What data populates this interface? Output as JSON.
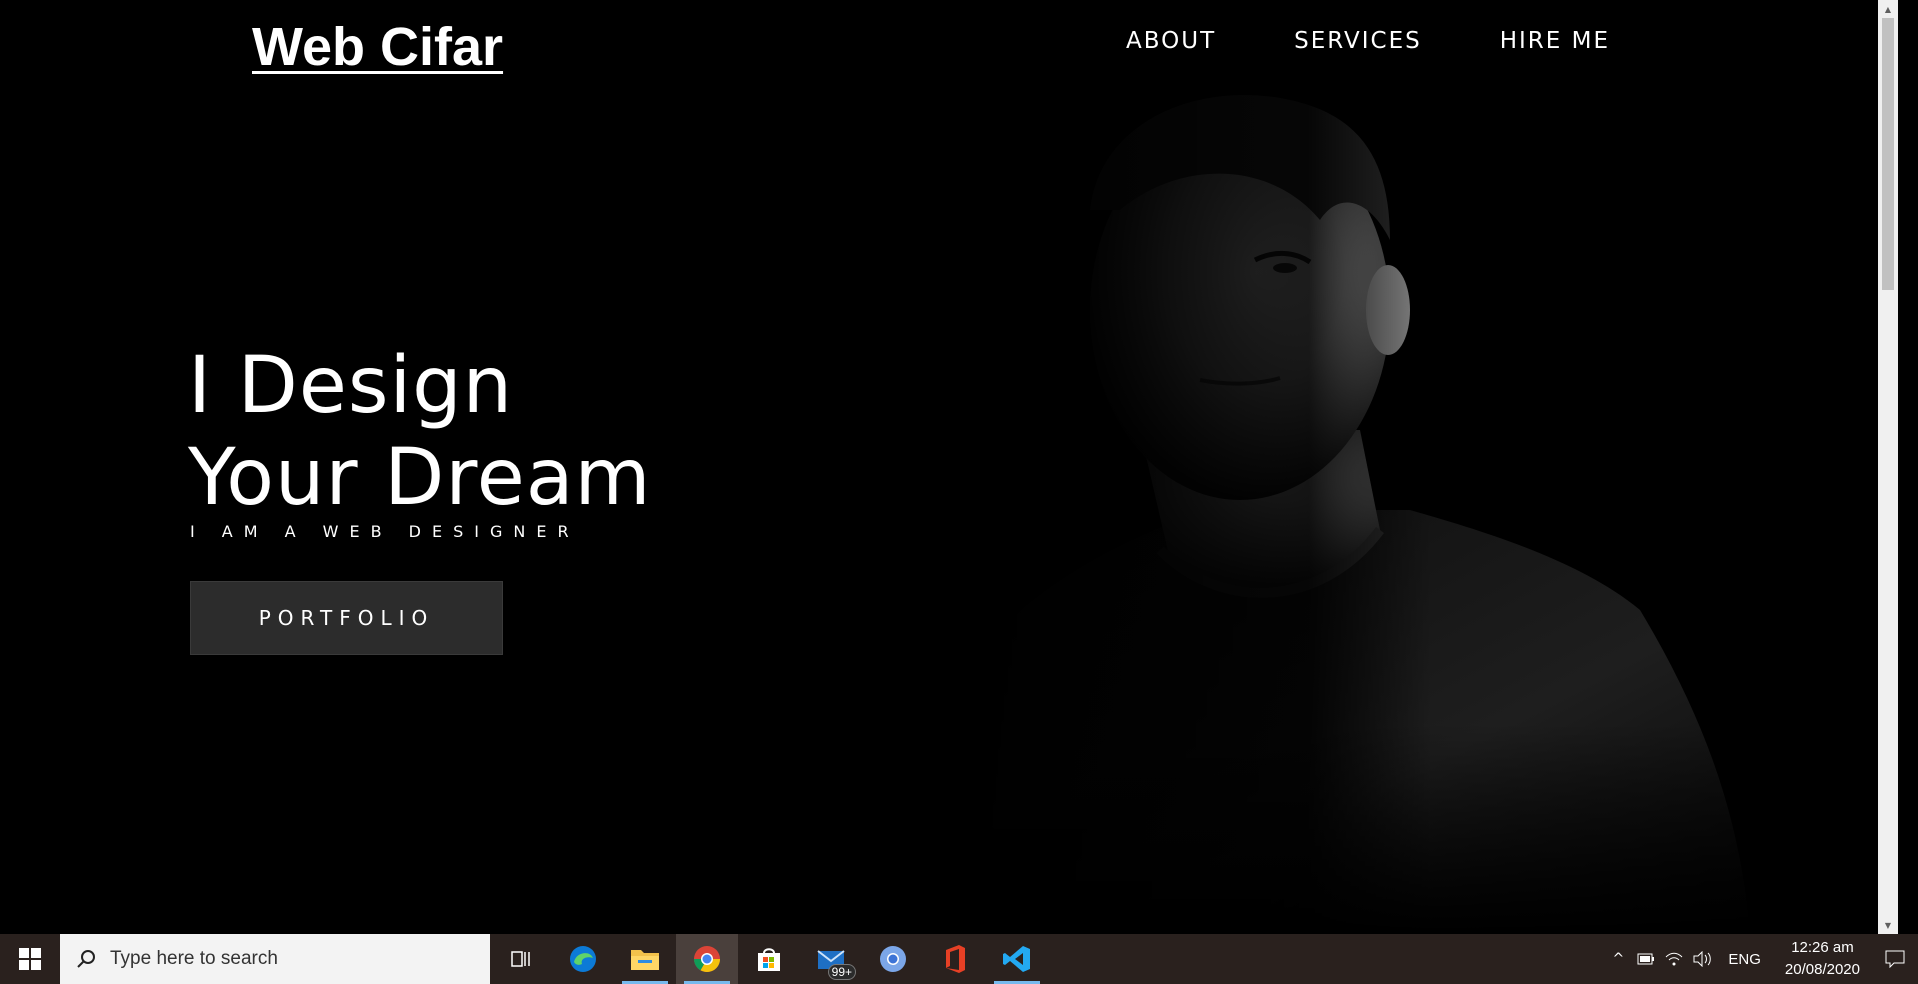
{
  "site": {
    "logo": "Web Cifar",
    "nav": [
      {
        "label": "ABOUT"
      },
      {
        "label": "SERVICES"
      },
      {
        "label": "HIRE ME"
      }
    ],
    "hero": {
      "line1": "I Design",
      "line2": "Your Dream",
      "subtitle": "I AM A WEB DESIGNER",
      "button": "PORTFOLIO"
    }
  },
  "taskbar": {
    "search_placeholder": "Type here to search",
    "mail_badge": "99+",
    "language": "ENG",
    "time": "12:26 am",
    "date": "20/08/2020",
    "icons": [
      "task-view",
      "edge",
      "file-explorer",
      "chrome",
      "store",
      "mail",
      "chromium",
      "office",
      "vscode"
    ]
  },
  "colors": {
    "background": "#000000",
    "button_bg": "#2c2c2c",
    "taskbar": "#2a211e",
    "active_underline": "#76b9ed"
  }
}
